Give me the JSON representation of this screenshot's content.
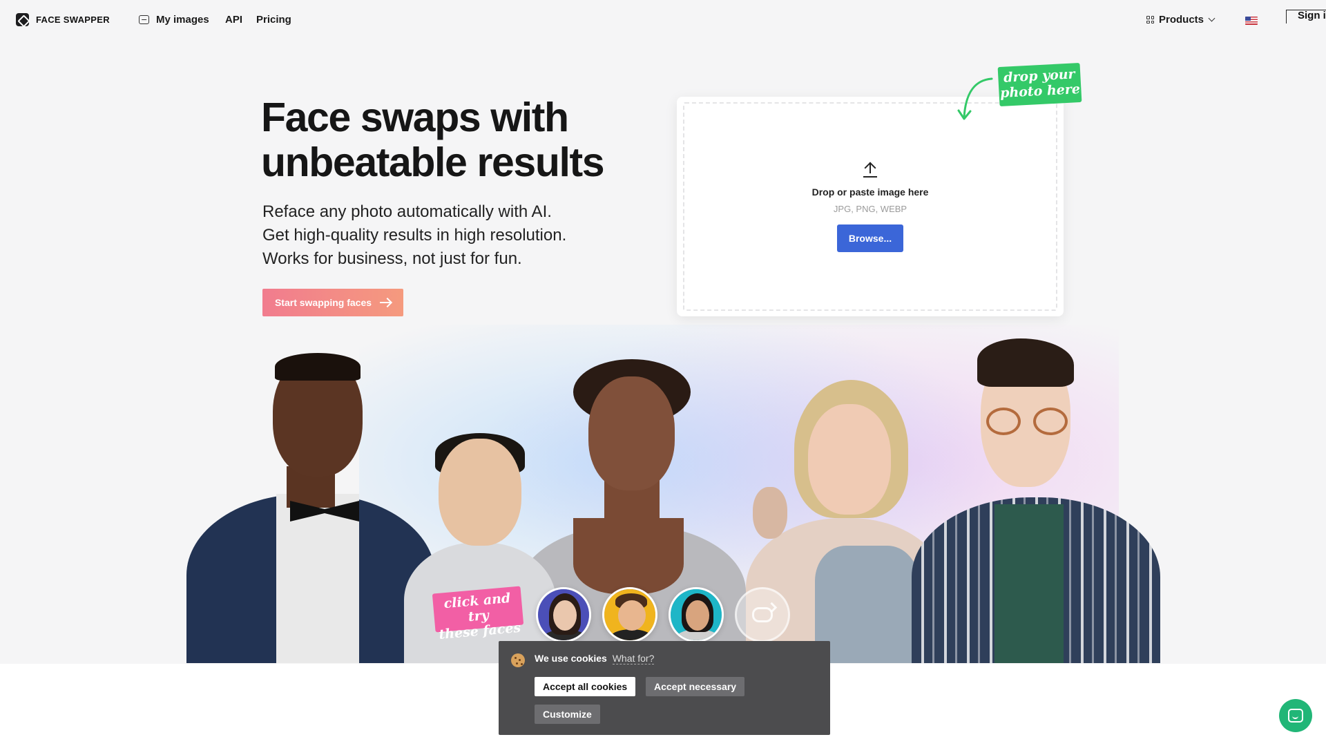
{
  "nav": {
    "brand": "FACE SWAPPER",
    "my_images": "My images",
    "api": "API",
    "pricing": "Pricing",
    "products": "Products",
    "language_flag": "us-flag-icon",
    "sign_in": "Sign in"
  },
  "hero": {
    "title_line1": "Face swaps with",
    "title_line2": "unbeatable results",
    "sub_line1": "Reface any photo automatically with AI.",
    "sub_line2": "Get high-quality results in high resolution.",
    "sub_line3": "Works for business, not just for fun.",
    "cta": "Start swapping faces"
  },
  "upload": {
    "drop_text": "Drop or paste image here",
    "formats": "JPG, PNG, WEBP",
    "browse": "Browse...",
    "sticker_line1": "drop your",
    "sticker_line2": "photo here"
  },
  "try_faces": {
    "sticker_line1": "click and try",
    "sticker_line2": "these faces"
  },
  "cookie": {
    "title": "We use cookies",
    "what_for": "What for?",
    "accept_all": "Accept all cookies",
    "accept_necessary": "Accept necessary",
    "customize": "Customize"
  },
  "colors": {
    "accent_blue": "#3b66d8",
    "cta_gradient_start": "#f17c8e",
    "cta_gradient_end": "#f59a7e",
    "sticker_green": "#34c968",
    "sticker_pink": "#f25fa5",
    "chat_green": "#21b677"
  }
}
